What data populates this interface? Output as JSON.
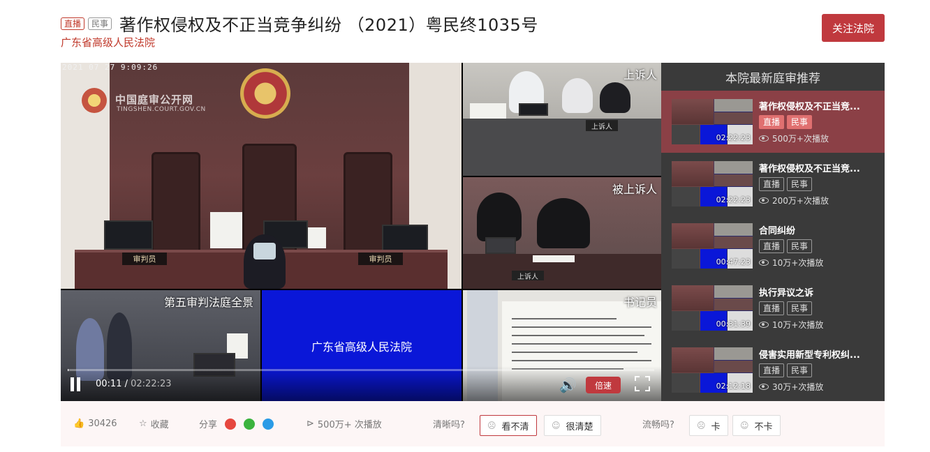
{
  "header": {
    "tag_live": "直播",
    "tag_civil": "民事",
    "title": "著作权侵权及不正当竞争纠纷 （2021）粤民终1035号",
    "court": "广东省高级人民法院",
    "follow_label": "关注法院"
  },
  "video": {
    "timestamp": "2021 07 27   9:09:26",
    "watermark_title": "中国庭审公开网",
    "watermark_url": "TINGSHEN.COURT.GOV.CN",
    "judge_plate": "审判员",
    "label_appellant": "上诉人",
    "label_appellee": "被上诉人",
    "label_overview": "第五审判法庭全景",
    "court_screen_text": "广东省高级人民法院",
    "label_clerk": "书记员",
    "desk_plate_appellant": "上诉人",
    "desk_plate_appellee": "上诉人",
    "current_time": "00:11",
    "duration": "02:22:23",
    "speed_label": "倍速",
    "progress": 0.0013
  },
  "sidebar": {
    "title": "本院最新庭审推荐",
    "items": [
      {
        "title": "著作权侵权及不正当竞...",
        "tag1": "直播",
        "tag2": "民事",
        "duration": "02:22:23",
        "views": "500万+次播放",
        "active": true
      },
      {
        "title": "著作权侵权及不正当竞...",
        "tag1": "直播",
        "tag2": "民事",
        "duration": "02:22:23",
        "views": "200万+次播放",
        "active": false
      },
      {
        "title": "合同纠纷",
        "tag1": "直播",
        "tag2": "民事",
        "duration": "00:47:23",
        "views": "10万+次播放",
        "active": false
      },
      {
        "title": "执行异议之诉",
        "tag1": "直播",
        "tag2": "民事",
        "duration": "00:31:39",
        "views": "10万+次播放",
        "active": false
      },
      {
        "title": "侵害实用新型专利权纠...",
        "tag1": "直播",
        "tag2": "民事",
        "duration": "02:12:18",
        "views": "30万+次播放",
        "active": false
      }
    ]
  },
  "bottom": {
    "likes": "30426",
    "favorite": "收藏",
    "share": "分享",
    "plays": "500万+ 次播放",
    "clarity_q": "清晰吗?",
    "unclear": "看不清",
    "clear": "很清楚",
    "smooth_q": "流畅吗?",
    "lag": "卡",
    "no_lag": "不卡"
  },
  "colors": {
    "accent": "#c0393e",
    "sidebar_bg": "#3a3a3a",
    "active_item": "#8b4046",
    "court_screen_blue": "#0a17d8"
  }
}
